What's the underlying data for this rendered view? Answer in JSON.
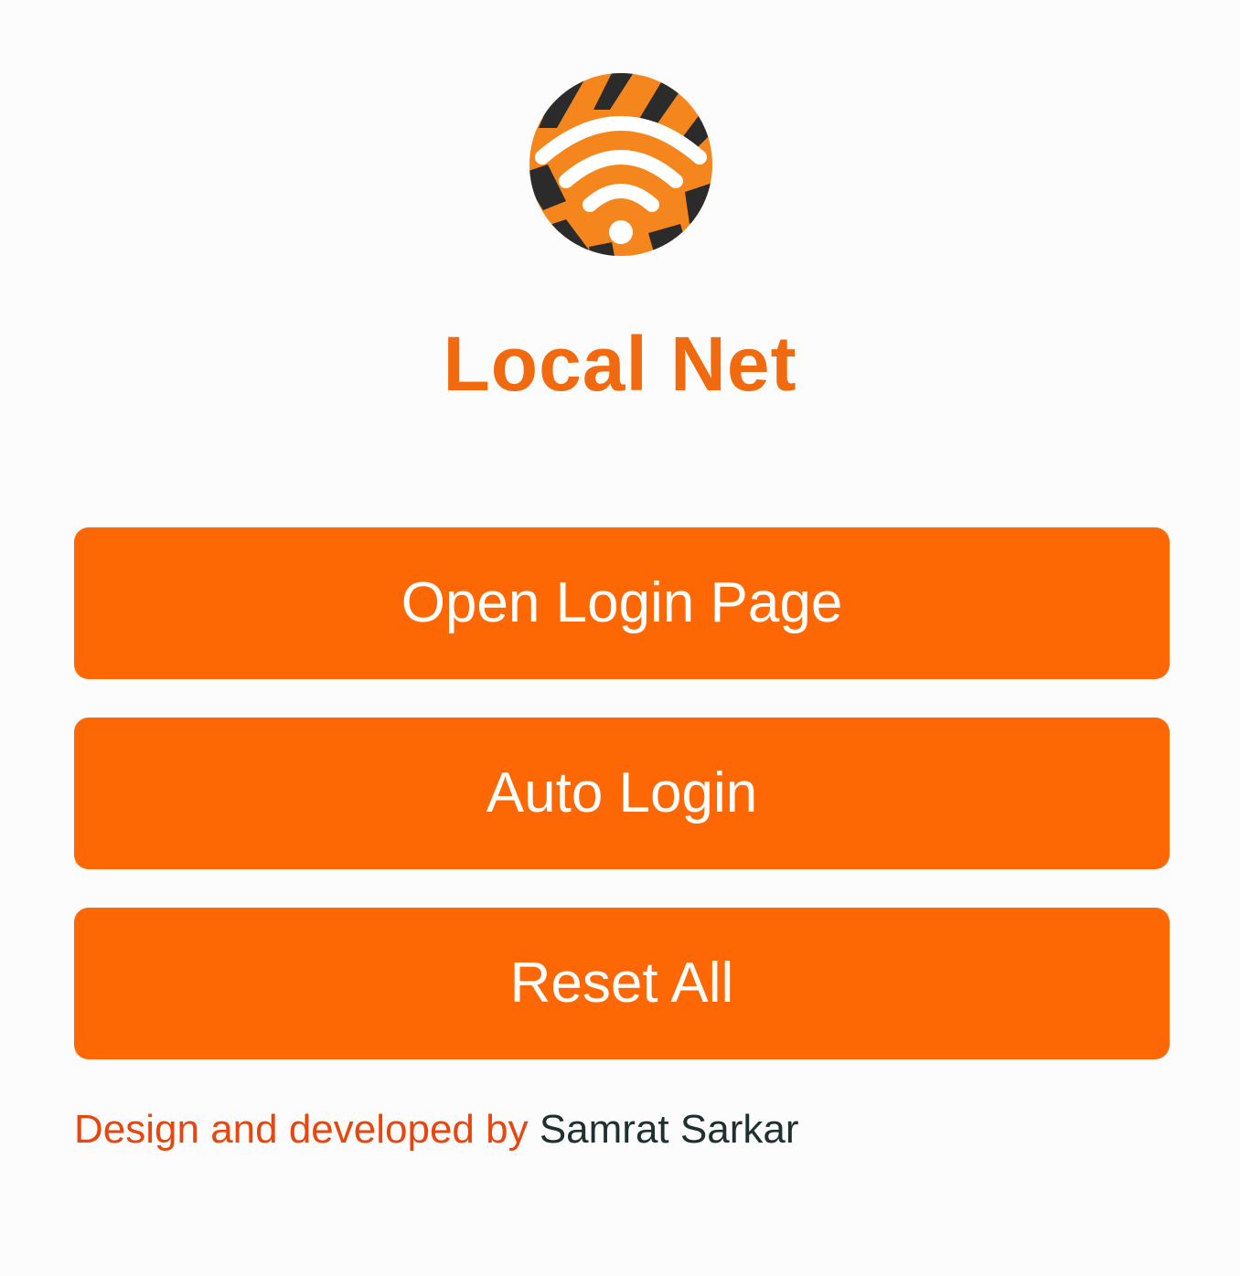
{
  "app": {
    "title": "Local Net",
    "logo_icon": "wifi-tiger-icon"
  },
  "actions": {
    "open_login_label": "Open Login Page",
    "auto_login_label": "Auto Login",
    "reset_label": "Reset All"
  },
  "footer": {
    "prefix": "Design and developed by",
    "author": "Samrat Sarkar"
  },
  "colors": {
    "accent": "#fd6704",
    "title": "#f26a0f",
    "footer_prefix": "#e8460f",
    "footer_author": "#1f3030",
    "background": "#fcfcfc"
  }
}
